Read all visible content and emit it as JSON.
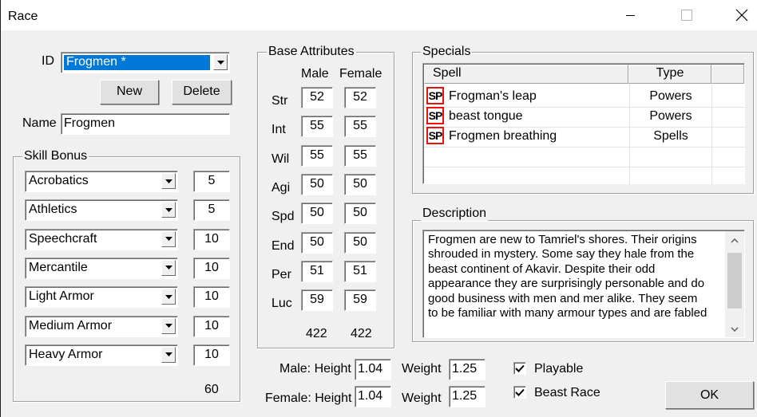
{
  "window": {
    "title": "Race",
    "controls": [
      "minimize-icon",
      "maximize-icon",
      "close-icon"
    ]
  },
  "id_field": {
    "label": "ID",
    "value": "Frogmen *"
  },
  "buttons": {
    "new": "New",
    "delete": "Delete",
    "ok": "OK"
  },
  "name_field": {
    "label": "Name",
    "value": "Frogmen"
  },
  "skill_bonus": {
    "title": "Skill Bonus",
    "items": [
      {
        "skill": "Acrobatics",
        "value": "5"
      },
      {
        "skill": "Athletics",
        "value": "5"
      },
      {
        "skill": "Speechcraft",
        "value": "10"
      },
      {
        "skill": "Mercantile",
        "value": "10"
      },
      {
        "skill": "Light Armor",
        "value": "10"
      },
      {
        "skill": "Medium Armor",
        "value": "10"
      },
      {
        "skill": "Heavy Armor",
        "value": "10"
      }
    ],
    "total": "60"
  },
  "base_attributes": {
    "title": "Base Attributes",
    "male_header": "Male",
    "female_header": "Female",
    "rows": [
      {
        "label": "Str",
        "male": "52",
        "female": "52"
      },
      {
        "label": "Int",
        "male": "55",
        "female": "55"
      },
      {
        "label": "Wil",
        "male": "55",
        "female": "55"
      },
      {
        "label": "Agi",
        "male": "50",
        "female": "50"
      },
      {
        "label": "Spd",
        "male": "50",
        "female": "50"
      },
      {
        "label": "End",
        "male": "50",
        "female": "50"
      },
      {
        "label": "Per",
        "male": "51",
        "female": "51"
      },
      {
        "label": "Luc",
        "male": "59",
        "female": "59"
      }
    ],
    "male_total": "422",
    "female_total": "422"
  },
  "specials": {
    "title": "Specials",
    "columns": [
      "Spell",
      "Type"
    ],
    "icon_text": "SP",
    "rows": [
      {
        "spell": "Frogman's leap",
        "type": "Powers"
      },
      {
        "spell": "beast tongue",
        "type": "Powers"
      },
      {
        "spell": "Frogmen breathing",
        "type": "Spells"
      }
    ]
  },
  "description": {
    "title": "Description",
    "lines": [
      "Frogmen are new to Tamriel's shores. Their origins",
      "shrouded in mystery. Some say they hale from the",
      "beast continent of Akavir. Despite their odd",
      "appearance they are surprisingly personable and do",
      "good business with men and mer alike. They seem",
      "to be familiar with many armour types and are fabled"
    ]
  },
  "dimensions": {
    "male_label": "Male: Height",
    "female_label": "Female: Height",
    "weight_label": "Weight",
    "male_height": "1.04",
    "male_weight": "1.25",
    "female_height": "1.04",
    "female_weight": "1.25"
  },
  "flags": {
    "playable": {
      "label": "Playable",
      "checked": true
    },
    "beast_race": {
      "label": "Beast Race",
      "checked": true
    }
  }
}
